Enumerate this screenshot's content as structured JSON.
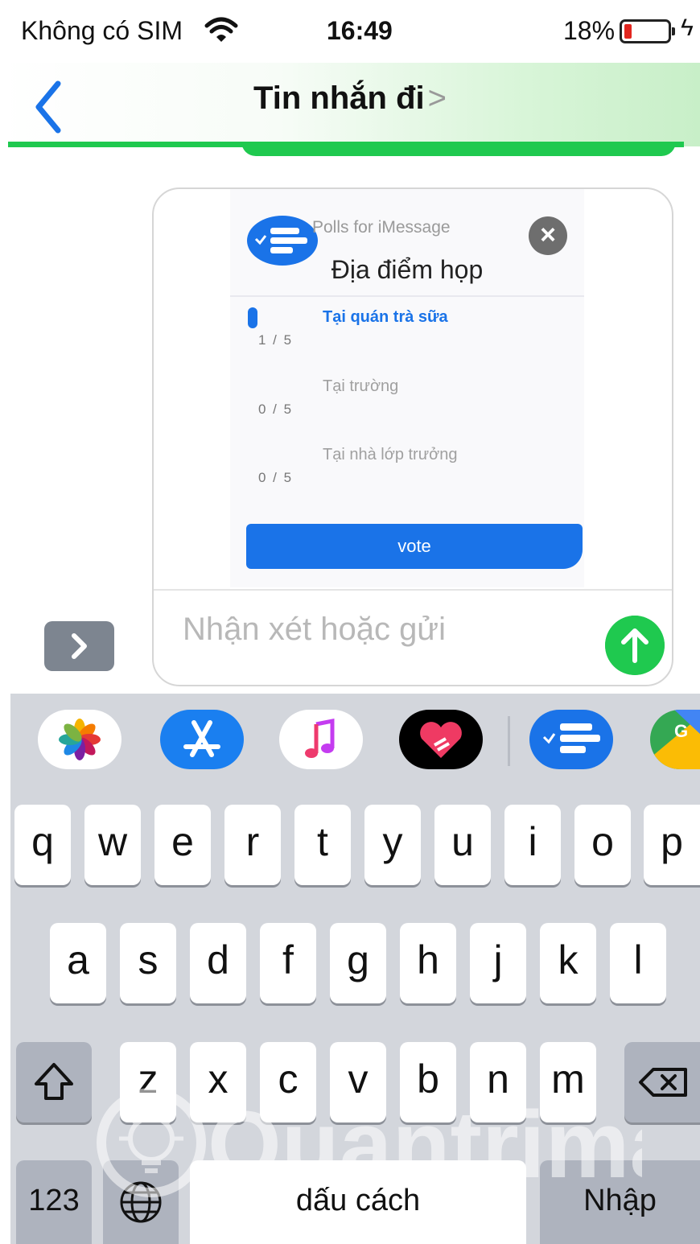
{
  "status_bar": {
    "carrier": "Không có SIM",
    "time": "16:49",
    "battery_percent": "18%",
    "battery_level": 0.18
  },
  "nav": {
    "title": "Tin nhắn đi",
    "title_chevron": ">"
  },
  "poll": {
    "app_name": "Polls for iMessage",
    "question": "Địa điểm họp",
    "options": [
      {
        "label": "Tại quán trà sữa",
        "count": "1 / 5",
        "selected": true
      },
      {
        "label": "Tại trường",
        "count": "0 / 5",
        "selected": false
      },
      {
        "label": "Tại nhà lớp trưởng",
        "count": "0 / 5",
        "selected": false
      }
    ],
    "vote_label": "vote"
  },
  "compose": {
    "placeholder": "Nhận xét hoặc gửi"
  },
  "app_strip": [
    "photos-icon",
    "app-store-icon",
    "music-icon",
    "heart-sticker-icon",
    "polls-icon",
    "google-maps-icon"
  ],
  "keyboard": {
    "row1": [
      "q",
      "w",
      "e",
      "r",
      "t",
      "y",
      "u",
      "i",
      "o",
      "p"
    ],
    "row2": [
      "a",
      "s",
      "d",
      "f",
      "g",
      "h",
      "j",
      "k",
      "l"
    ],
    "row3": [
      "z",
      "x",
      "c",
      "v",
      "b",
      "n",
      "m"
    ],
    "numbers_key": "123",
    "space_key": "dấu cách",
    "return_key": "Nhập"
  },
  "watermark": "Quantrimang",
  "colors": {
    "accent_blue": "#1a73e8",
    "imessage_green": "#1fc94f",
    "keyboard_bg": "#d3d6dc"
  }
}
